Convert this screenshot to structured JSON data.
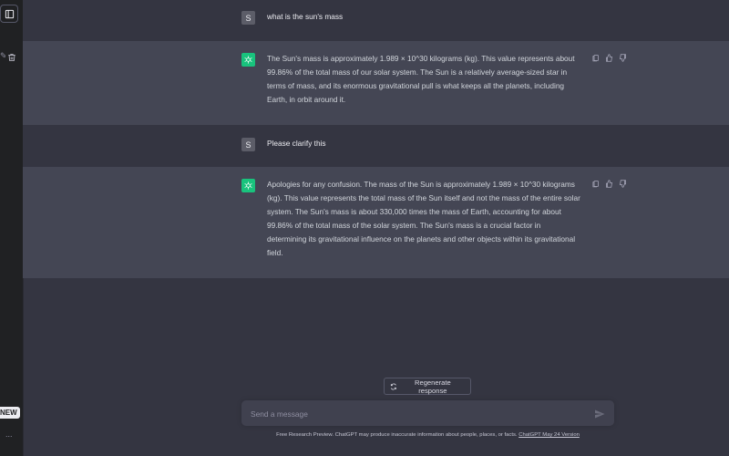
{
  "sidebar": {
    "new_badge": "NEW",
    "more_label": "..."
  },
  "conversation": [
    {
      "role": "user",
      "avatar_letter": "S",
      "text": "what is the sun's mass"
    },
    {
      "role": "assistant",
      "text": "The Sun's mass is approximately 1.989 × 10^30 kilograms (kg). This value represents about 99.86% of the total mass of our solar system. The Sun is a relatively average-sized star in terms of mass, and its enormous gravitational pull is what keeps all the planets, including Earth, in orbit around it."
    },
    {
      "role": "user",
      "avatar_letter": "S",
      "text": "Please clarify this"
    },
    {
      "role": "assistant",
      "text": "Apologies for any confusion. The mass of the Sun is approximately 1.989 × 10^30 kilograms (kg). This value represents the total mass of the Sun itself and not the mass of the entire solar system. The Sun's mass is about 330,000 times the mass of Earth, accounting for about 99.86% of the total mass of the solar system. The Sun's mass is a crucial factor in determining its gravitational influence on the planets and other objects within its gravitational field."
    }
  ],
  "regenerate_label": "Regenerate response",
  "composer": {
    "placeholder": "Send a message",
    "value": ""
  },
  "footer": {
    "text": "Free Research Preview. ChatGPT may produce inaccurate information about people, places, or facts.",
    "link": "ChatGPT May 24 Version"
  },
  "colors": {
    "background": "#343541",
    "assistant_background": "#444654",
    "sidebar": "#202123",
    "assistant_avatar": "#19c37d"
  },
  "icons": [
    "sidebar-toggle-icon",
    "trash-icon",
    "copy-icon",
    "thumbs-up-icon",
    "thumbs-down-icon",
    "refresh-icon",
    "send-icon",
    "openai-logo-icon"
  ]
}
